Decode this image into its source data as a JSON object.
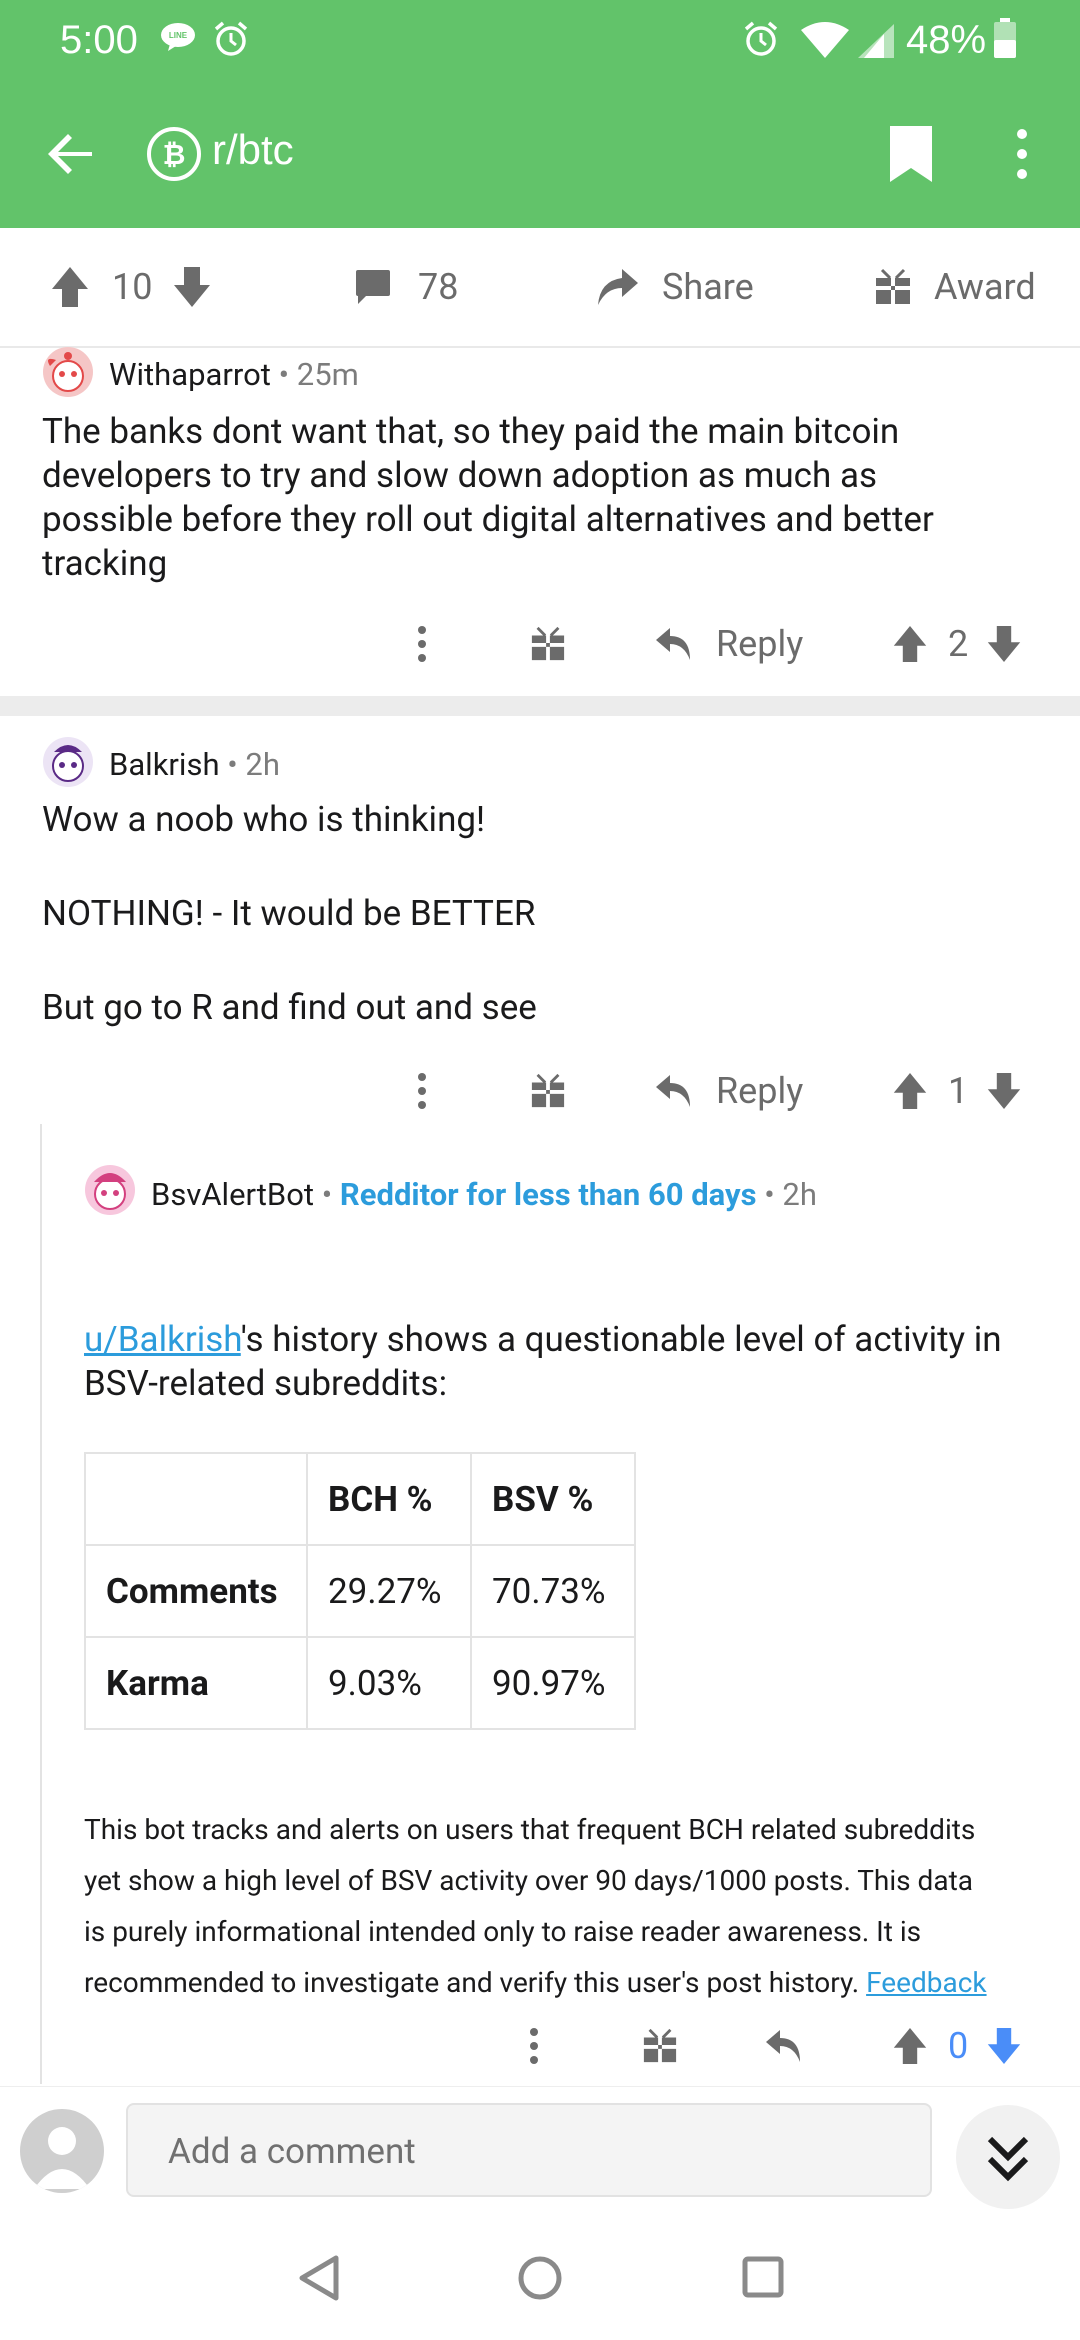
{
  "status_bar": {
    "time": "5:00",
    "battery": "48%"
  },
  "app_bar": {
    "subreddit": "r/btc"
  },
  "post_actions": {
    "score": "10",
    "comments": "78",
    "share": "Share",
    "award": "Award"
  },
  "comments": [
    {
      "author": "Withaparrot",
      "age": "25m",
      "lines": [
        "The banks dont want that, so they paid the main bitcoin",
        "developers to try and slow down adoption as much as",
        "possible before they roll out digital alternatives and better",
        "tracking"
      ],
      "reply_label": "Reply",
      "score": "2"
    },
    {
      "author": "Balkrish",
      "age": "2h",
      "paragraphs": [
        "Wow a noob who is thinking!",
        "NOTHING! - It would be BETTER",
        "But go to R and find out and see"
      ],
      "reply_label": "Reply",
      "score": "1"
    },
    {
      "author": "BsvAlertBot",
      "flair": "Redditor for less than 60 days",
      "age": "2h",
      "intro_link": "u/Balkrish",
      "intro_line1_rest": "'s history shows a questionable level of activity in",
      "intro_line2": "BSV-related subreddits:",
      "table": {
        "headers": [
          "",
          "BCH %",
          "BSV %"
        ],
        "rows": [
          {
            "label": "Comments",
            "bch": "29.27%",
            "bsv": "70.73%"
          },
          {
            "label": "Karma",
            "bch": "9.03%",
            "bsv": "90.97%"
          }
        ]
      },
      "footer_lines": [
        "This bot tracks and alerts on users that frequent BCH related subreddits",
        "yet show a high level of BSV activity over 90 days/1000 posts. This data",
        "is purely informational intended only to raise reader awareness. It is",
        "recommended to investigate and verify this user's post history."
      ],
      "footer_link": "Feedback",
      "score": "0"
    }
  ],
  "composer": {
    "placeholder": "Add a comment"
  },
  "colors": {
    "header": "#62c36a",
    "link": "#2c9cdc",
    "upvote_active": "#4a8df8"
  }
}
